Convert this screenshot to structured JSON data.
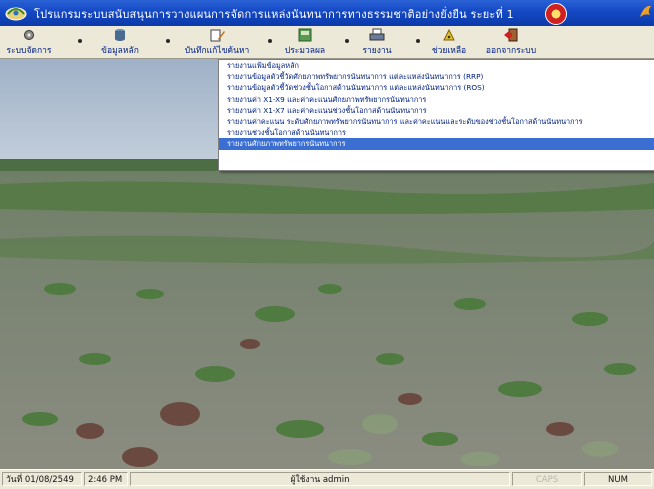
{
  "window": {
    "title": "โปรแกรมระบบสนับสนุนการวางแผนการจัดการแหล่งนันทนาการทางธรรมชาติอย่างยั่งยืน ระยะที่ 1"
  },
  "toolbar": {
    "items": [
      {
        "label": "ระบบจัดการ",
        "icon": "gear-icon"
      },
      {
        "label": "ข้อมูลหลัก",
        "icon": "database-icon"
      },
      {
        "label": "บันทึกแก้ไขค้นหา",
        "icon": "edit-icon"
      },
      {
        "label": "ประมวลผล",
        "icon": "process-icon"
      },
      {
        "label": "รายงาน",
        "icon": "printer-icon"
      },
      {
        "label": "ช่วยเหลือ",
        "icon": "help-icon"
      },
      {
        "label": "ออกจากระบบ",
        "icon": "exit-icon"
      }
    ]
  },
  "report_menu": {
    "items": [
      "รายงานแฟ้มข้อมูลหลัก",
      "รายงานข้อมูลตัวชี้วัดศักยภาพทรัพยากรนันทนาการ แต่ละแหล่งนันทนาการ (RRP)",
      "รายงานข้อมูลตัวชี้วัดช่วงชั้นโอกาสด้านนันทนาการ แต่ละแหล่งนันทนาการ (ROS)",
      "รายงานค่า X1-X9 และค่าคะแนนศักยภาพทรัพยากรนันทนาการ",
      "รายงานค่า X1-X7 และค่าคะแนนช่วงชั้นโอกาสด้านนันทนาการ",
      "รายงานค่าคะแนน ระดับศักยภาพทรัพยากรนันทนาการ และค่าคะแนนและระดับของช่วงชั้นโอกาสด้านนันทนาการ",
      "รายงานช่วงชั้นโอกาสด้านนันทนาการ",
      "รายงานศักยภาพทรัพยากรนันทนาการ"
    ],
    "selected_index": 7
  },
  "status": {
    "date": "วันที่ 01/08/2549",
    "time": "2:46 PM",
    "user": "ผู้ใช้งาน admin",
    "caps": "CAPS",
    "num": "NUM"
  },
  "colors": {
    "title_bar": "#1448c4",
    "menu_highlight": "#3a6fd1",
    "menu_text": "#002080"
  }
}
